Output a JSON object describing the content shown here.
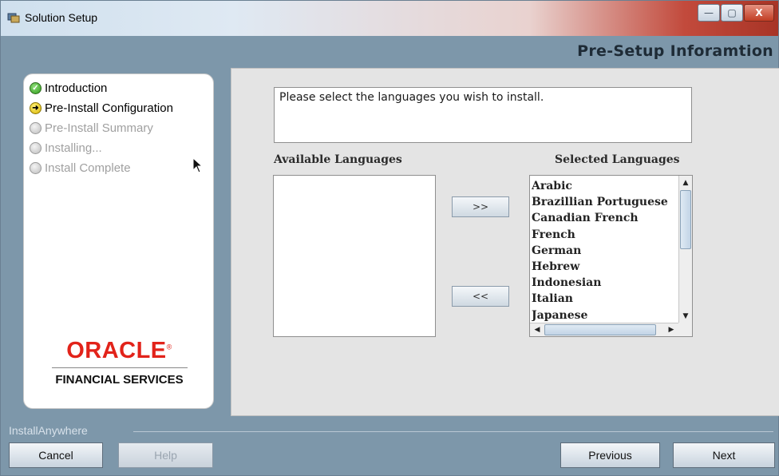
{
  "window": {
    "title": "Solution Setup",
    "icon": "installer-icon",
    "controls": {
      "minimize": "—",
      "maximize": "▢",
      "close": "X"
    }
  },
  "header": {
    "title": "Pre-Setup Inforamtion"
  },
  "steps": [
    {
      "label": "Introduction",
      "state": "done"
    },
    {
      "label": "Pre-Install Configuration",
      "state": "current"
    },
    {
      "label": "Pre-Install Summary",
      "state": "pending"
    },
    {
      "label": "Installing...",
      "state": "pending"
    },
    {
      "label": "Install Complete",
      "state": "pending"
    }
  ],
  "branding": {
    "logo": "ORACLE",
    "trademark": "®",
    "subtitle": "FINANCIAL SERVICES"
  },
  "main": {
    "prompt": "Please select the languages you wish to install.",
    "available_label": "Available Languages",
    "selected_label": "Selected Languages",
    "add_button": ">>",
    "remove_button": "<<",
    "available_items": [],
    "selected_items": [
      "Arabic",
      "Brazillian Portuguese",
      "Canadian French",
      "French",
      "German",
      "Hebrew",
      "Indonesian",
      "Italian",
      "Japanese"
    ]
  },
  "footer": {
    "brand": "InstallAnywhere",
    "cancel": "Cancel",
    "help": "Help",
    "previous": "Previous",
    "next": "Next"
  },
  "colors": {
    "window_bg": "#7d97aa",
    "panel_bg": "#e4e4e4",
    "oracle_red": "#e2231a"
  }
}
